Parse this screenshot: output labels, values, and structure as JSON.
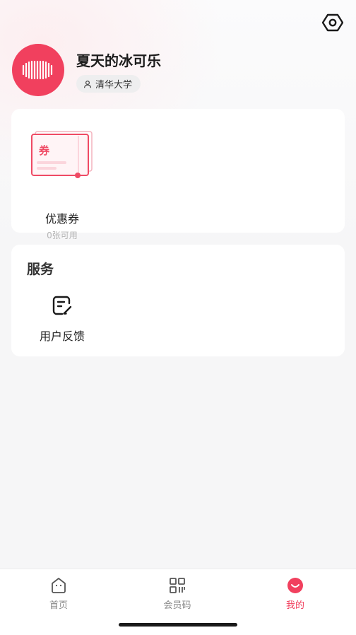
{
  "profile": {
    "username": "夏天的冰可乐",
    "school": "清华大学"
  },
  "coupon": {
    "label": "优惠券",
    "count_text": "0张可用",
    "ticket_char": "券"
  },
  "services": {
    "title": "服务",
    "items": [
      {
        "label": "用户反馈",
        "icon": "feedback-edit-icon"
      }
    ]
  },
  "tabbar": {
    "tabs": [
      {
        "label": "首页",
        "icon": "home-icon",
        "active": false
      },
      {
        "label": "会员码",
        "icon": "qr-code-icon",
        "active": false
      },
      {
        "label": "我的",
        "icon": "smile-face-icon",
        "active": true
      }
    ]
  },
  "colors": {
    "accent": "#f1405e",
    "background": "#f6f6f7",
    "card": "#ffffff"
  }
}
